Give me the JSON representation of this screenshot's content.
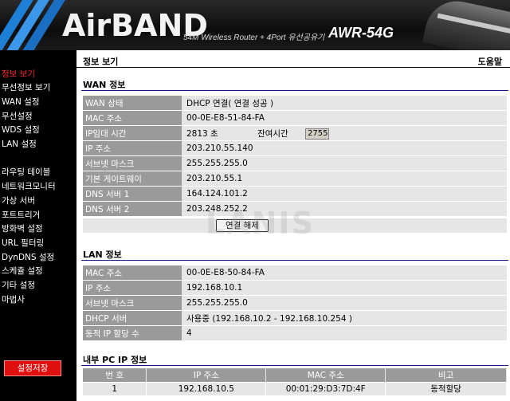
{
  "banner": {
    "logo_text": "AirBAND",
    "tagline": "54M Wireless Router + 4Port 유선공유기",
    "model": "AWR-54G"
  },
  "sidebar": {
    "items": [
      {
        "label": "정보 보기",
        "active": true
      },
      {
        "label": "무선정보 보기"
      },
      {
        "label": "WAN 설정"
      },
      {
        "label": "무선설정"
      },
      {
        "label": "WDS 설정"
      },
      {
        "label": "LAN 설정"
      },
      {
        "label": "라우팅 테이블"
      },
      {
        "label": "네트워크모니터"
      },
      {
        "label": "가상 서버"
      },
      {
        "label": "포트트리거"
      },
      {
        "label": "방화벽 설정"
      },
      {
        "label": "URL 필터링"
      },
      {
        "label": "DynDNS 설정"
      },
      {
        "label": "스케쥴 설정"
      },
      {
        "label": "기타 설정"
      },
      {
        "label": "마법사"
      }
    ],
    "save_label": "설정저장"
  },
  "header": {
    "title": "정보 보기",
    "help": "도움말"
  },
  "wan": {
    "title": "WAN 정보",
    "rows": [
      {
        "label": "WAN 상태",
        "value": "DHCP 연결( 연결 성공 )"
      },
      {
        "label": "MAC 주소",
        "value": "00-0E-E8-51-84-FA"
      },
      {
        "label": "IP임대 시간",
        "value": "2813 초"
      },
      {
        "label": "IP 주소",
        "value": "203.210.55.140"
      },
      {
        "label": "서브넷 마스크",
        "value": "255.255.255.0"
      },
      {
        "label": "기본 게이트웨이",
        "value": "203.210.55.1"
      },
      {
        "label": "DNS 서버 1",
        "value": "164.124.101.2"
      },
      {
        "label": "DNS 서버 2",
        "value": "203.248.252.2"
      }
    ],
    "remain_label": "잔여시간",
    "remain_value": "2755",
    "disconnect_label": "연결 해제"
  },
  "lan": {
    "title": "LAN 정보",
    "rows": [
      {
        "label": "MAC 주소",
        "value": "00-0E-E8-50-84-FA"
      },
      {
        "label": "IP 주소",
        "value": "192.168.10.1"
      },
      {
        "label": "서브넷 마스크",
        "value": "255.255.255.0"
      },
      {
        "label": "DHCP 서버",
        "value": "사용중 (192.168.10.2 - 192.168.10.254 )"
      },
      {
        "label": "동적 IP 할당 수",
        "value": "4"
      }
    ]
  },
  "pc": {
    "title": "내부 PC IP 정보",
    "columns": [
      "번 호",
      "IP 주소",
      "MAC 주소",
      "비고"
    ],
    "rows": [
      [
        "1",
        "192.168.10.5",
        "00:01:29:D3:7D:4F",
        "동적할당"
      ]
    ]
  },
  "watermark": "LANIS",
  "colors": {
    "accent_blue": "#1d7fd6",
    "active_menu": "#ff2a2a",
    "save_button": "#e01010",
    "label_cell": "#9a9a9a",
    "value_cell": "#e6e6e6"
  }
}
